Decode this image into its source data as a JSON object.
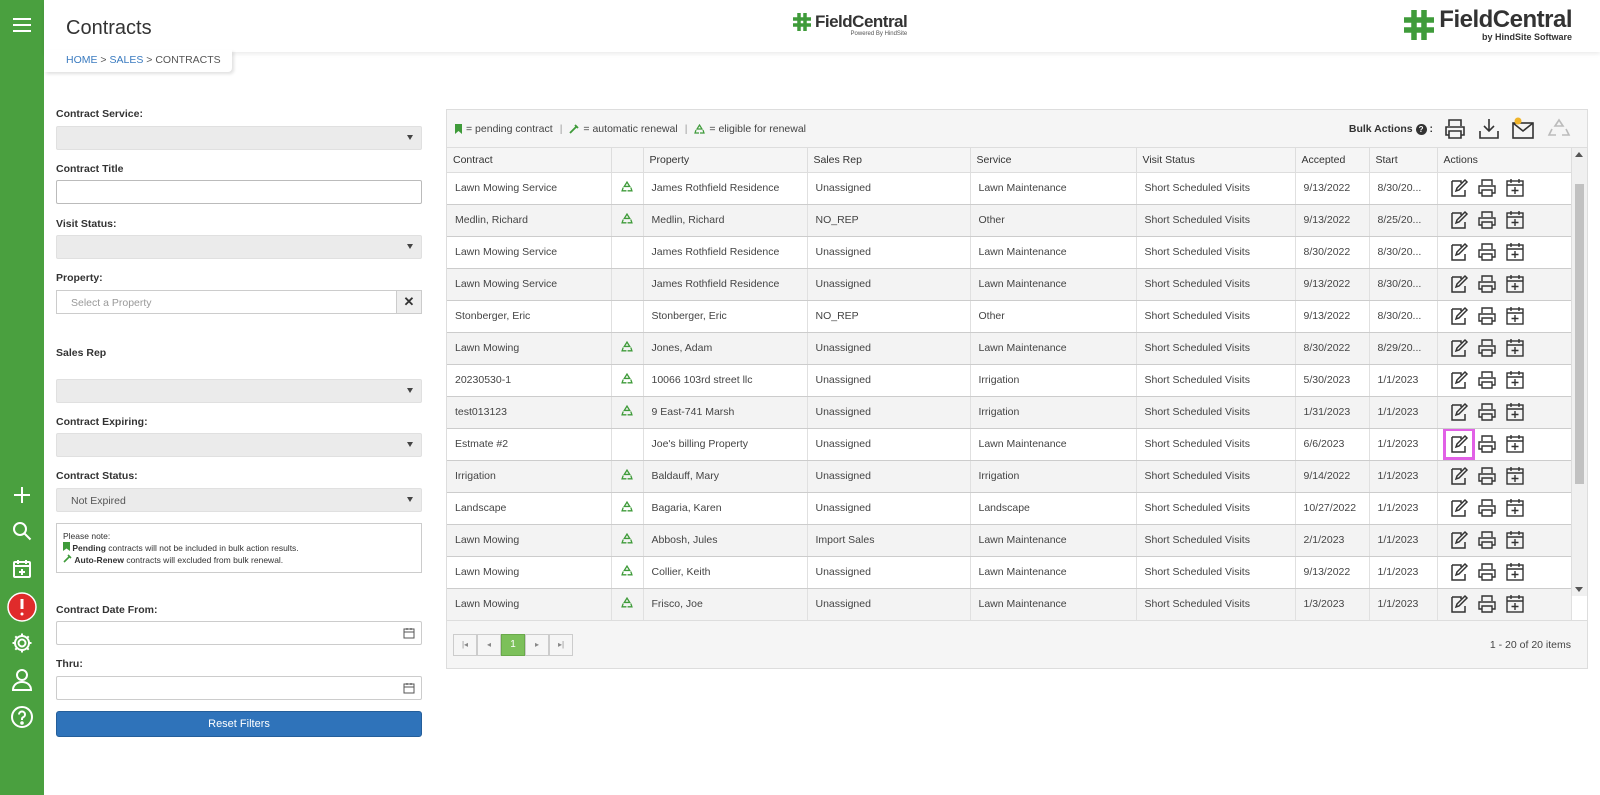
{
  "header": {
    "title": "Contracts",
    "breadcrumb": {
      "home": "HOME",
      "sales": "SALES",
      "current": "CONTRACTS",
      "sep": ">"
    },
    "logo_center": {
      "name": "FieldCentral",
      "sub": "Powered By HindSite"
    },
    "logo_right": {
      "name": "FieldCentral",
      "sub": "by HindSite Software"
    }
  },
  "colors": {
    "rail": "#4aa03f",
    "accent_blue": "#2f73ba",
    "highlight": "#e160e6",
    "page_current": "#7cc05a"
  },
  "filters": {
    "contract_service_label": "Contract Service:",
    "contract_title_label": "Contract Title",
    "visit_status_label": "Visit Status:",
    "property_label": "Property:",
    "property_placeholder": "Select a Property",
    "property_clear": "✕",
    "sales_rep_label": "Sales Rep",
    "contract_expiring_label": "Contract Expiring:",
    "contract_status_label": "Contract Status:",
    "contract_status_value": "Not Expired",
    "note": {
      "heading": "Please note:",
      "line1_bold": "Pending",
      "line1_rest": " contracts will not be included in bulk action results.",
      "line2_bold": "Auto-Renew",
      "line2_rest": " contracts will excluded from bulk renewal."
    },
    "date_from_label": "Contract Date From:",
    "thru_label": "Thru:",
    "reset_label": "Reset Filters"
  },
  "legend": {
    "pending": "= pending contract",
    "auto": "= automatic renewal",
    "eligible": "= eligible for renewal",
    "sep": "|"
  },
  "bulk_actions_label": "Bulk Actions",
  "bulk_actions_colon": ":",
  "bulk_help_glyph": "?",
  "columns": [
    "Contract",
    "",
    "Property",
    "Sales Rep",
    "Service",
    "Visit Status",
    "Accepted",
    "Start",
    "Actions"
  ],
  "rows": [
    {
      "contract": "Lawn Mowing Service",
      "recycle": true,
      "property": "James Rothfield Residence",
      "rep": "Unassigned",
      "service": "Lawn Maintenance",
      "visit": "Short Scheduled Visits",
      "accepted": "9/13/2022",
      "start": "8/30/20..."
    },
    {
      "contract": "Medlin, Richard",
      "recycle": true,
      "property": "Medlin, Richard",
      "rep": "NO_REP",
      "service": "Other",
      "visit": "Short Scheduled Visits",
      "accepted": "9/13/2022",
      "start": "8/25/20..."
    },
    {
      "contract": "Lawn Mowing Service",
      "recycle": false,
      "property": "James Rothfield Residence",
      "rep": "Unassigned",
      "service": "Lawn Maintenance",
      "visit": "Short Scheduled Visits",
      "accepted": "8/30/2022",
      "start": "8/30/20..."
    },
    {
      "contract": "Lawn Mowing Service",
      "recycle": false,
      "property": "James Rothfield Residence",
      "rep": "Unassigned",
      "service": "Lawn Maintenance",
      "visit": "Short Scheduled Visits",
      "accepted": "9/13/2022",
      "start": "8/30/20..."
    },
    {
      "contract": "Stonberger, Eric",
      "recycle": false,
      "property": "Stonberger, Eric",
      "rep": "NO_REP",
      "service": "Other",
      "visit": "Short Scheduled Visits",
      "accepted": "9/13/2022",
      "start": "8/30/20..."
    },
    {
      "contract": "Lawn Mowing",
      "recycle": true,
      "property": "Jones, Adam",
      "rep": "Unassigned",
      "service": "Lawn Maintenance",
      "visit": "Short Scheduled Visits",
      "accepted": "8/30/2022",
      "start": "8/29/20..."
    },
    {
      "contract": "20230530-1",
      "recycle": true,
      "property": "10066 103rd street llc",
      "rep": "Unassigned",
      "service": "Irrigation",
      "visit": "Short Scheduled Visits",
      "accepted": "5/30/2023",
      "start": "1/1/2023"
    },
    {
      "contract": "test013123",
      "recycle": true,
      "property": "9 East-741 Marsh",
      "rep": "Unassigned",
      "service": "Irrigation",
      "visit": "Short Scheduled Visits",
      "accepted": "1/31/2023",
      "start": "1/1/2023"
    },
    {
      "contract": "Estmate #2",
      "recycle": false,
      "property": "Joe's billing Property",
      "rep": "Unassigned",
      "service": "Lawn Maintenance",
      "visit": "Short Scheduled Visits",
      "accepted": "6/6/2023",
      "start": "1/1/2023",
      "highlight": true
    },
    {
      "contract": "Irrigation",
      "recycle": true,
      "property": "Baldauff, Mary",
      "rep": "Unassigned",
      "service": "Irrigation",
      "visit": "Short Scheduled Visits",
      "accepted": "9/14/2022",
      "start": "1/1/2023"
    },
    {
      "contract": "Landscape",
      "recycle": true,
      "property": "Bagaria, Karen",
      "rep": "Unassigned",
      "service": "Landscape",
      "visit": "Short Scheduled Visits",
      "accepted": "10/27/2022",
      "start": "1/1/2023"
    },
    {
      "contract": "Lawn Mowing",
      "recycle": true,
      "property": "Abbosh, Jules",
      "rep": "Import Sales",
      "service": "Lawn Maintenance",
      "visit": "Short Scheduled Visits",
      "accepted": "2/1/2023",
      "start": "1/1/2023"
    },
    {
      "contract": "Lawn Mowing",
      "recycle": true,
      "property": "Collier, Keith",
      "rep": "Unassigned",
      "service": "Lawn Maintenance",
      "visit": "Short Scheduled Visits",
      "accepted": "9/13/2022",
      "start": "1/1/2023"
    },
    {
      "contract": "Lawn Mowing",
      "recycle": true,
      "property": "Frisco, Joe",
      "rep": "Unassigned",
      "service": "Lawn Maintenance",
      "visit": "Short Scheduled Visits",
      "accepted": "1/3/2023",
      "start": "1/1/2023"
    }
  ],
  "pager": {
    "first": "|◂",
    "prev": "◂",
    "current": "1",
    "next": "▸",
    "last": "▸|",
    "count": "1 - 20 of 20 items"
  }
}
